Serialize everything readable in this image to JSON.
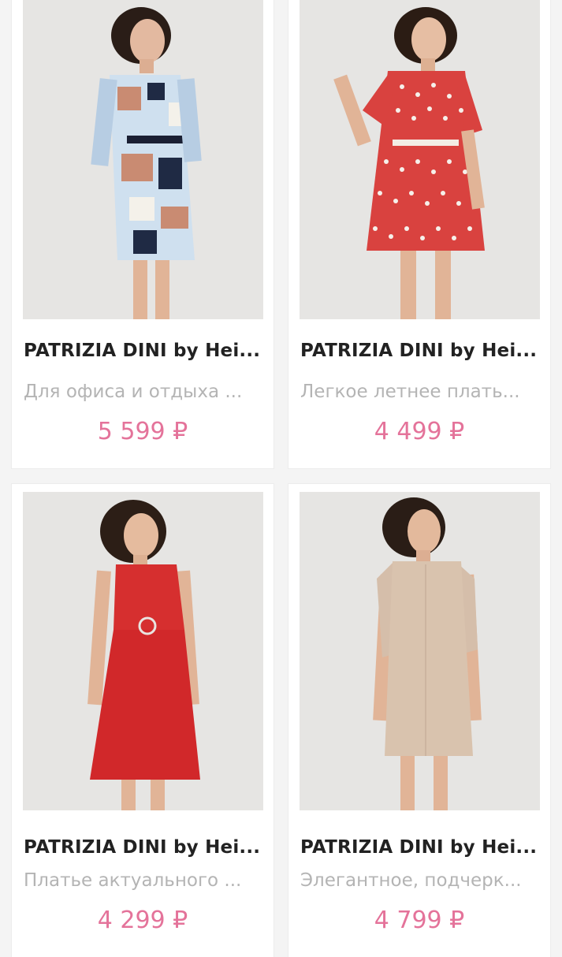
{
  "currency_symbol": "₽",
  "accent_color": "#e4739a",
  "products": [
    {
      "brand": "PATRIZIA DINI by Heine",
      "brand_display": "PATRIZIA DINI by Hei...",
      "description": "Для офиса и отдыха ...",
      "price": "5 599 ₽",
      "image": "woman-in-geometric-print-belted-dress"
    },
    {
      "brand": "PATRIZIA DINI by Heine",
      "brand_display": "PATRIZIA DINI by Hei...",
      "description": "Легкое летнее плать...",
      "price": "4 499 ₽",
      "image": "woman-in-red-polka-dot-dress"
    },
    {
      "brand": "PATRIZIA DINI by Heine",
      "brand_display": "PATRIZIA DINI by Hei...",
      "description": "Платье актуального ...",
      "price": "4 299 ₽",
      "image": "woman-in-red-sleeveless-dress"
    },
    {
      "brand": "PATRIZIA DINI by Heine",
      "brand_display": "PATRIZIA DINI by Hei...",
      "description": "Элегантное, подчерк...",
      "price": "4 799 ₽",
      "image": "woman-in-beige-shift-dress"
    }
  ]
}
